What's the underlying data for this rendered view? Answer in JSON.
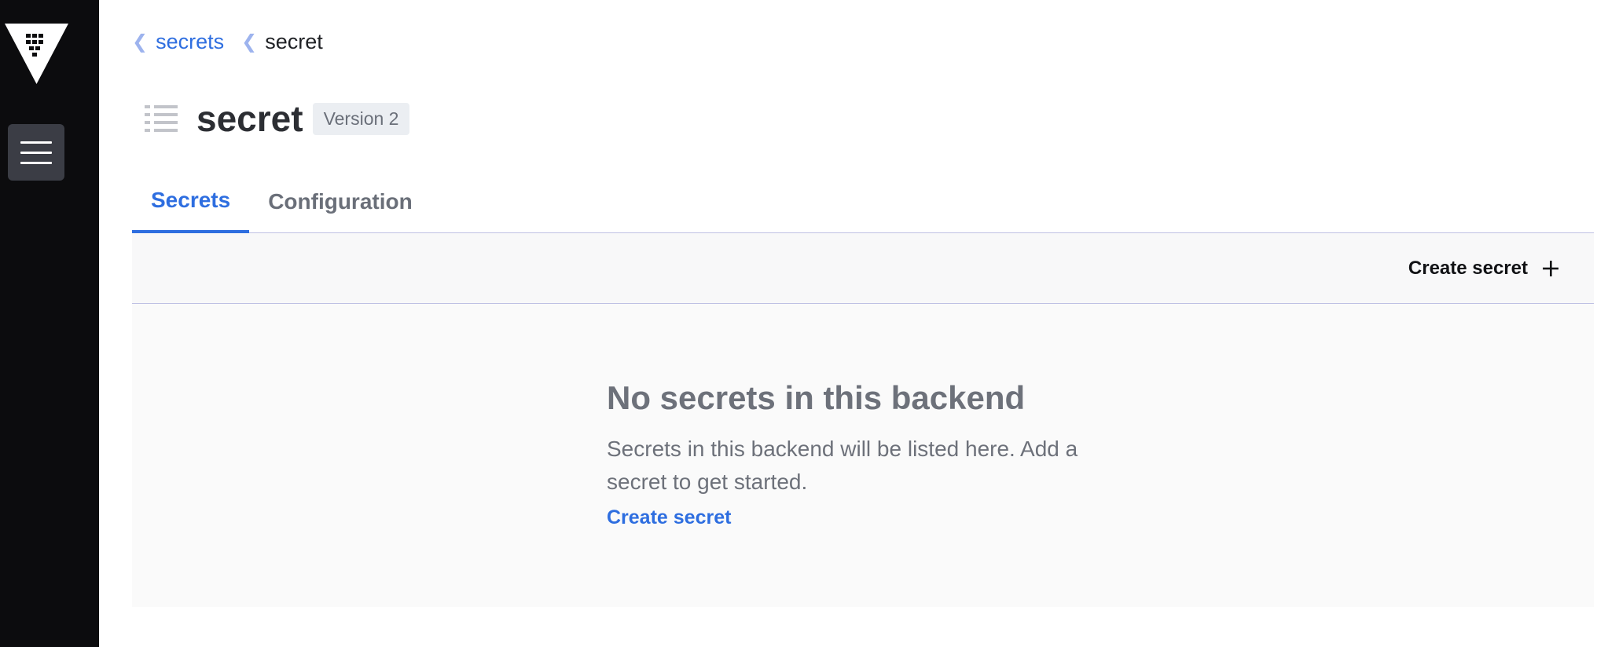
{
  "sidebar": {
    "logo_icon": "vault-logo-icon",
    "menu_icon": "hamburger-menu-icon"
  },
  "breadcrumb": {
    "items": [
      {
        "label": "secrets",
        "link": true
      },
      {
        "label": "secret",
        "link": false
      }
    ],
    "separator_icon": "chevron-left-icon"
  },
  "header": {
    "icon": "list-icon",
    "title": "secret",
    "badge": "Version 2"
  },
  "tabs": [
    {
      "label": "Secrets",
      "active": true
    },
    {
      "label": "Configuration",
      "active": false
    }
  ],
  "toolbar": {
    "create_label": "Create secret",
    "create_icon": "plus-icon"
  },
  "empty_state": {
    "title": "No secrets in this backend",
    "message": "Secrets in this backend will be listed here. Add a secret to get started.",
    "link_label": "Create secret"
  },
  "colors": {
    "accent": "#2e6ee0",
    "sidebar": "#0c0c0e",
    "menu_button": "#3b3d45",
    "muted_text": "#6d717a"
  }
}
